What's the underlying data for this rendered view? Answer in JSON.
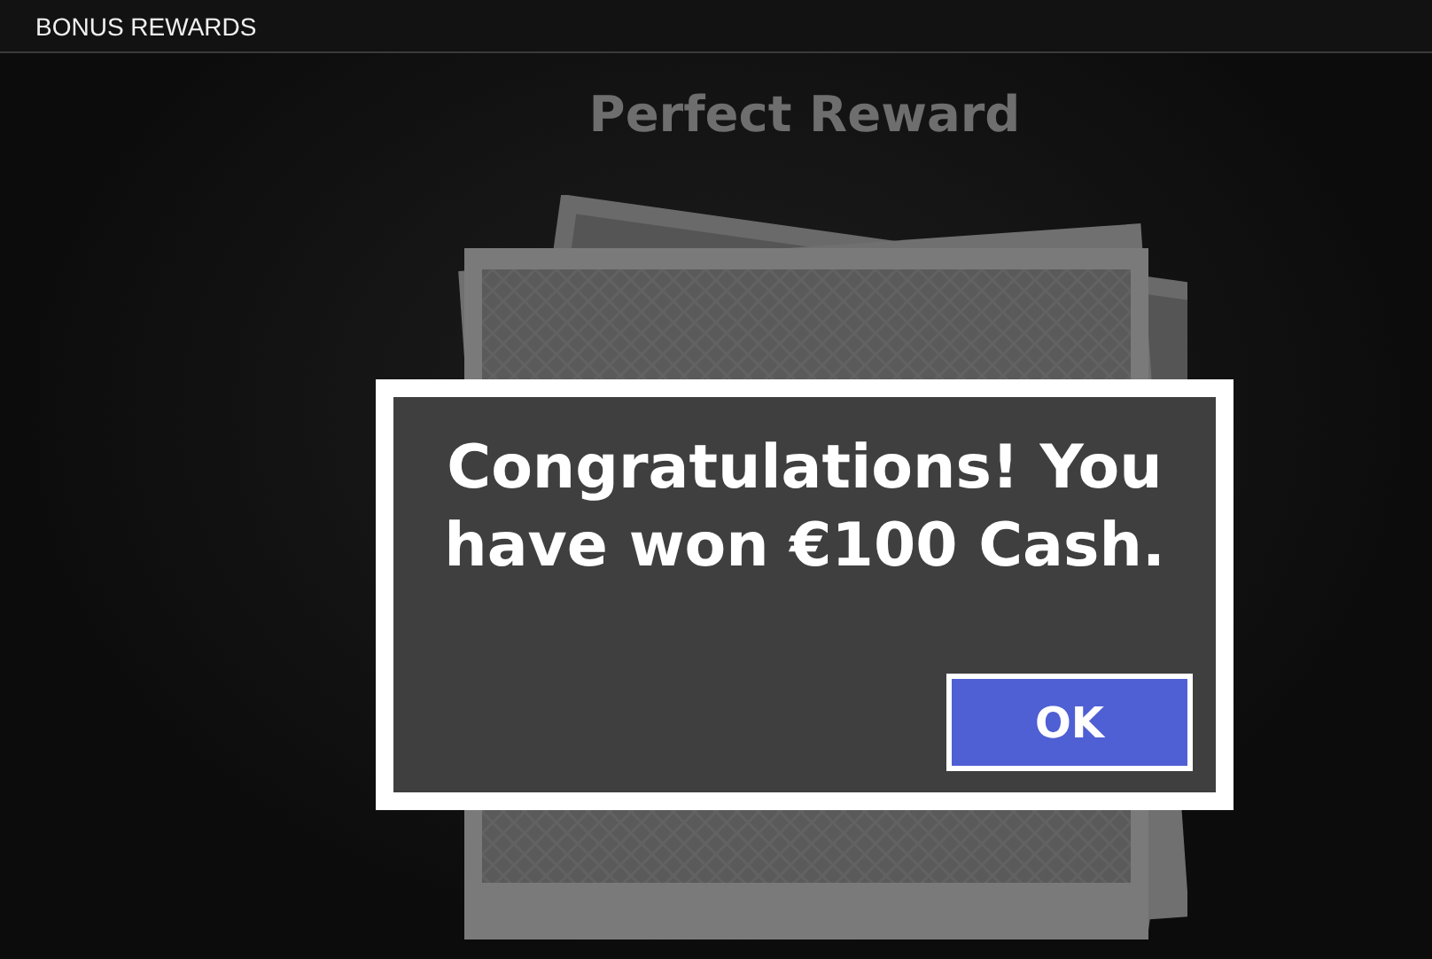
{
  "header": {
    "title": "BONUS REWARDS"
  },
  "stage": {
    "title": "Perfect Reward"
  },
  "dialog": {
    "message": "Congratulations! You have won €100 Cash.",
    "buttons": [
      "OK"
    ]
  }
}
